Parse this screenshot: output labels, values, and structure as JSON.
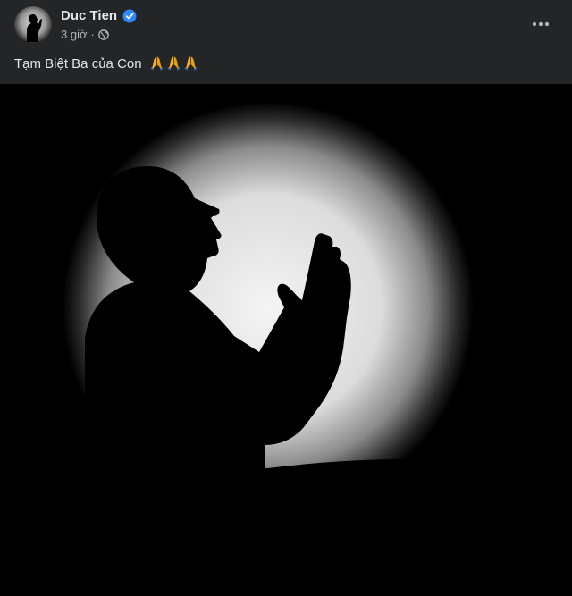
{
  "post": {
    "author_name": "Duc Tien",
    "verified": true,
    "timestamp": "3 giờ",
    "privacy_icon": "globe-icon",
    "text": "Tạm Biệt Ba của Con",
    "emojis": [
      "folded-hands-icon",
      "folded-hands-icon",
      "folded-hands-icon"
    ],
    "more_icon": "more-horizontal-icon",
    "image_subject": "praying-silhouette-image"
  },
  "colors": {
    "background": "#242526",
    "primary_text": "#e4e6eb",
    "secondary_text": "#b0b3b8",
    "verified_badge": "#2d88ff",
    "emoji": "#f6b31b"
  }
}
